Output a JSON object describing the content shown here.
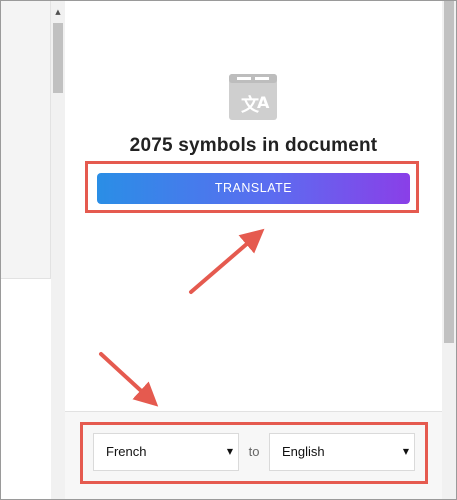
{
  "panel": {
    "symbols_text": "2075 symbols in document",
    "translate_label": "TRANSLATE",
    "source_language": "French",
    "to_label": "to",
    "target_language": "English"
  },
  "icons": {
    "translate": "translate-icon",
    "caret": "caret-down-icon",
    "scroll_up": "scroll-up-arrow-icon"
  },
  "colors": {
    "button_gradient_start": "#2a8ee6",
    "button_gradient_end": "#8a3fe8",
    "annotation_red": "#e55a4f",
    "icon_gray": "#cfcfcf"
  }
}
